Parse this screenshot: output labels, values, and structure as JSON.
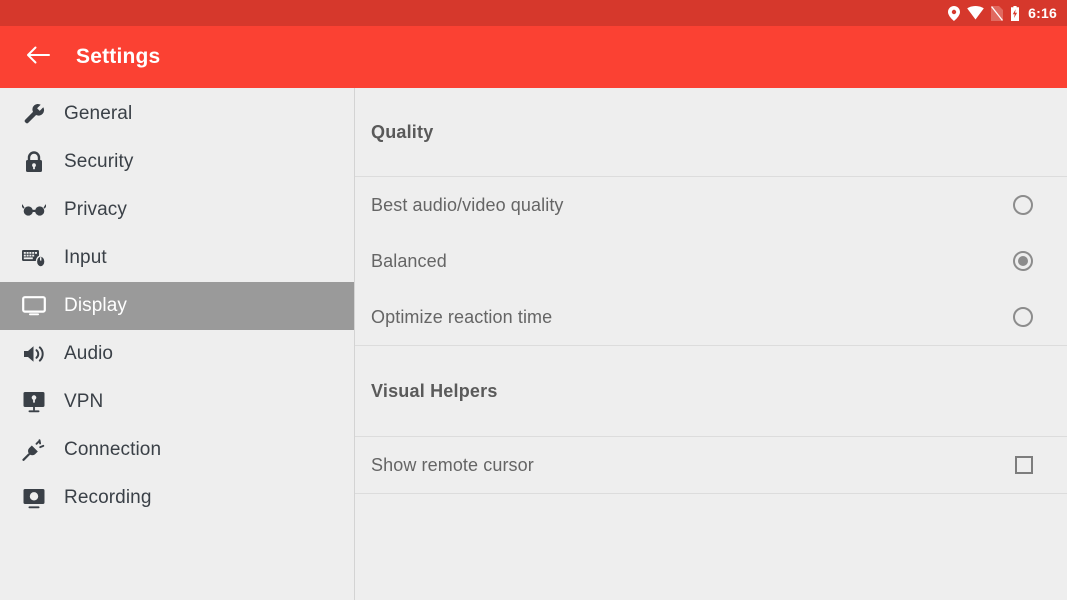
{
  "status_bar": {
    "time": "6:16",
    "icons": [
      "location-icon",
      "wifi-icon",
      "sim-missing-icon",
      "battery-charging-icon"
    ],
    "background_color": "#d6382c"
  },
  "app_bar": {
    "back_label": "back-arrow",
    "title": "Settings",
    "background_color": "#fb4133"
  },
  "sidebar": {
    "selected_color": "#9a9a9a",
    "items": [
      {
        "label": "General",
        "icon": "wrench-icon",
        "selected": false
      },
      {
        "label": "Security",
        "icon": "lock-icon",
        "selected": false
      },
      {
        "label": "Privacy",
        "icon": "glasses-icon",
        "selected": false
      },
      {
        "label": "Input",
        "icon": "keyboard-mouse-icon",
        "selected": false
      },
      {
        "label": "Display",
        "icon": "monitor-icon",
        "selected": true
      },
      {
        "label": "Audio",
        "icon": "speaker-icon",
        "selected": false
      },
      {
        "label": "VPN",
        "icon": "vpn-monitor-icon",
        "selected": false
      },
      {
        "label": "Connection",
        "icon": "plug-icon",
        "selected": false
      },
      {
        "label": "Recording",
        "icon": "record-monitor-icon",
        "selected": false
      }
    ]
  },
  "main": {
    "sections": [
      {
        "title": "Quality",
        "control_type": "radio",
        "options": [
          {
            "label": "Best audio/video quality",
            "checked": false
          },
          {
            "label": "Balanced",
            "checked": true
          },
          {
            "label": "Optimize reaction time",
            "checked": false
          }
        ]
      },
      {
        "title": "Visual Helpers",
        "control_type": "checkbox",
        "options": [
          {
            "label": "Show remote cursor",
            "checked": false
          }
        ]
      }
    ]
  }
}
